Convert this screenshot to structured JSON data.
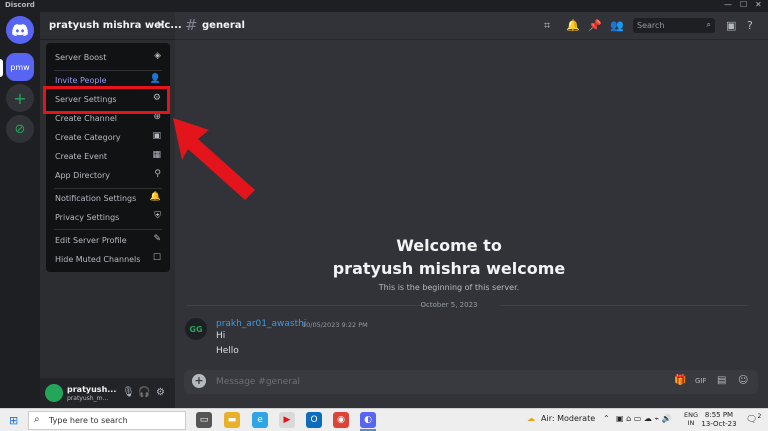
{
  "titlebar": {
    "title": "Discord",
    "minimize": "—",
    "maximize": "☐",
    "close": "✕"
  },
  "rail": {
    "home_icon": "discord-logo",
    "server_abbr": "pmw",
    "add_icon": "+",
    "explore_icon": "compass"
  },
  "sidebar": {
    "server_name": "pratyush mishra welc...",
    "close_glyph": "✕"
  },
  "menu": {
    "items": [
      {
        "label": "Server Boost",
        "icon": "◈"
      },
      {
        "label": "Invite People",
        "icon": "👤"
      },
      {
        "label": "Server Settings",
        "icon": "⚙"
      },
      {
        "label": "Create Channel",
        "icon": "⊕"
      },
      {
        "label": "Create Category",
        "icon": "▣"
      },
      {
        "label": "Create Event",
        "icon": "▦"
      },
      {
        "label": "App Directory",
        "icon": "⚲"
      },
      {
        "label": "Notification Settings",
        "icon": "🔔"
      },
      {
        "label": "Privacy Settings",
        "icon": "⛨"
      },
      {
        "label": "Edit Server Profile",
        "icon": "✎"
      },
      {
        "label": "Hide Muted Channels",
        "icon": "☐"
      }
    ]
  },
  "userbar": {
    "name": "pratyush...",
    "tag": "pratyush_m...",
    "mic": "🎙",
    "headphones": "🎧",
    "settings": "⚙"
  },
  "channel": {
    "hash": "#",
    "name": "general",
    "search_placeholder": "Search"
  },
  "welcome": {
    "line1": "Welcome to",
    "line2": "pratyush mishra welcome",
    "line3": "This is the beginning of this server."
  },
  "divider_date": "October 5, 2023",
  "message": {
    "avatar_text": "GG",
    "author": "prakh_ar01_awasthi",
    "timestamp": "10/05/2023 9:22 PM",
    "lines": [
      "Hi",
      "Hello"
    ]
  },
  "composer": {
    "placeholder": "Message #general"
  },
  "taskbar": {
    "search_placeholder": "Type here to search",
    "weather": "Air: Moderate",
    "lang1": "ENG",
    "lang2": "IN",
    "time": "8:55 PM",
    "date": "13-Oct-23",
    "notifications": "2"
  },
  "colors": {
    "accent": "#5865f2",
    "highlight_box": "#e4141c",
    "link": "#3b9be0",
    "online": "#23a55a"
  }
}
